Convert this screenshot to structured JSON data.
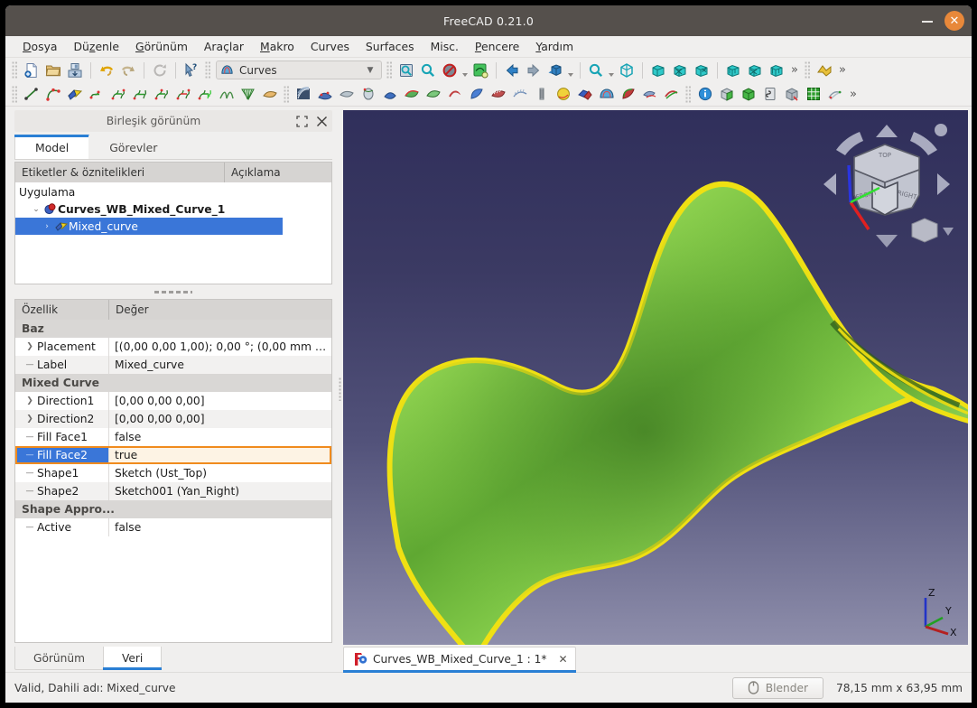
{
  "window": {
    "title": "FreeCAD 0.21.0",
    "minimize_label": "–",
    "close_label": "✕"
  },
  "menubar": [
    {
      "label": "Dosya",
      "accel": "D"
    },
    {
      "label": "Düzenle",
      "accel": "z"
    },
    {
      "label": "Görünüm",
      "accel": "G"
    },
    {
      "label": "Araçlar",
      "accel": ""
    },
    {
      "label": "Makro",
      "accel": "M"
    },
    {
      "label": "Curves",
      "accel": ""
    },
    {
      "label": "Surfaces",
      "accel": ""
    },
    {
      "label": "Misc.",
      "accel": ""
    },
    {
      "label": "Pencere",
      "accel": "P"
    },
    {
      "label": "Yardım",
      "accel": "Y"
    }
  ],
  "toolbar": {
    "workbench_selected": "Curves",
    "overflow_label": "»"
  },
  "combined_view": {
    "title": "Birleşik görünüm",
    "undock_icon": "undock-icon",
    "close_icon": "close-icon",
    "tabs": [
      {
        "label": "Model",
        "active": true
      },
      {
        "label": "Görevler",
        "active": false
      }
    ]
  },
  "tree": {
    "columns": [
      "Etiketler & öznitelikleri",
      "Açıklama"
    ],
    "rows": [
      {
        "label": "Uygulama",
        "depth": 0,
        "arrow": "",
        "icon": "",
        "bold": false,
        "selected": false
      },
      {
        "label": "Curves_WB_Mixed_Curve_1",
        "depth": 1,
        "arrow": "⌄",
        "icon": "document-icon",
        "bold": true,
        "selected": false
      },
      {
        "label": "Mixed_curve",
        "depth": 2,
        "arrow": "›",
        "icon": "mixed-curve-icon",
        "bold": false,
        "selected": true
      }
    ]
  },
  "properties": {
    "columns": [
      "Özellik",
      "Değer"
    ],
    "rows": [
      {
        "kind": "group",
        "name": "Baz"
      },
      {
        "kind": "prop",
        "name": "Placement",
        "value": "[(0,00 0,00 1,00); 0,00 °; (0,00 mm  …",
        "expandable": true
      },
      {
        "kind": "prop",
        "name": "Label",
        "value": "Mixed_curve",
        "expandable": false
      },
      {
        "kind": "group",
        "name": "Mixed Curve"
      },
      {
        "kind": "prop",
        "name": "Direction1",
        "value": "[0,00 0,00 0,00]",
        "expandable": true
      },
      {
        "kind": "prop",
        "name": "Direction2",
        "value": "[0,00 0,00 0,00]",
        "expandable": true
      },
      {
        "kind": "prop",
        "name": "Fill Face1",
        "value": "false",
        "expandable": false
      },
      {
        "kind": "prop",
        "name": "Fill Face2",
        "value": "true",
        "expandable": false,
        "highlight": true
      },
      {
        "kind": "prop",
        "name": "Shape1",
        "value": "Sketch (Ust_Top)",
        "expandable": false
      },
      {
        "kind": "prop",
        "name": "Shape2",
        "value": "Sketch001 (Yan_Right)",
        "expandable": false
      },
      {
        "kind": "group",
        "name": "Shape Appro..."
      },
      {
        "kind": "prop",
        "name": "Active",
        "value": "false",
        "expandable": false
      }
    ]
  },
  "left_bottom_tabs": [
    {
      "label": "Görünüm",
      "active": false
    },
    {
      "label": "Veri",
      "active": true
    }
  ],
  "document_tab": {
    "label": "Curves_WB_Mixed_Curve_1 : 1*",
    "close_label": "✕",
    "icon": "freecad-doc-icon"
  },
  "statusbar": {
    "message": "Valid, Dahili adı: Mixed_curve",
    "blender_button": "Blender",
    "dimensions": "78,15 mm x 63,95 mm"
  },
  "viewport": {
    "nav_cube_faces": [
      "TOP",
      "FRONT",
      "RIGHT"
    ],
    "axes": {
      "x": "X",
      "y": "Y",
      "z": "Z"
    }
  },
  "colors": {
    "accent_blue": "#2a7fd4",
    "selection_blue": "#3a76d8",
    "highlight_orange": "#f08b1d",
    "close_orange": "#e8883a",
    "titlebar": "#55504c",
    "surface_green": "#7ed148",
    "surface_edge_yellow": "#f2e40b",
    "bg_top": "#302f5b",
    "bg_bottom": "#8e8eab"
  }
}
